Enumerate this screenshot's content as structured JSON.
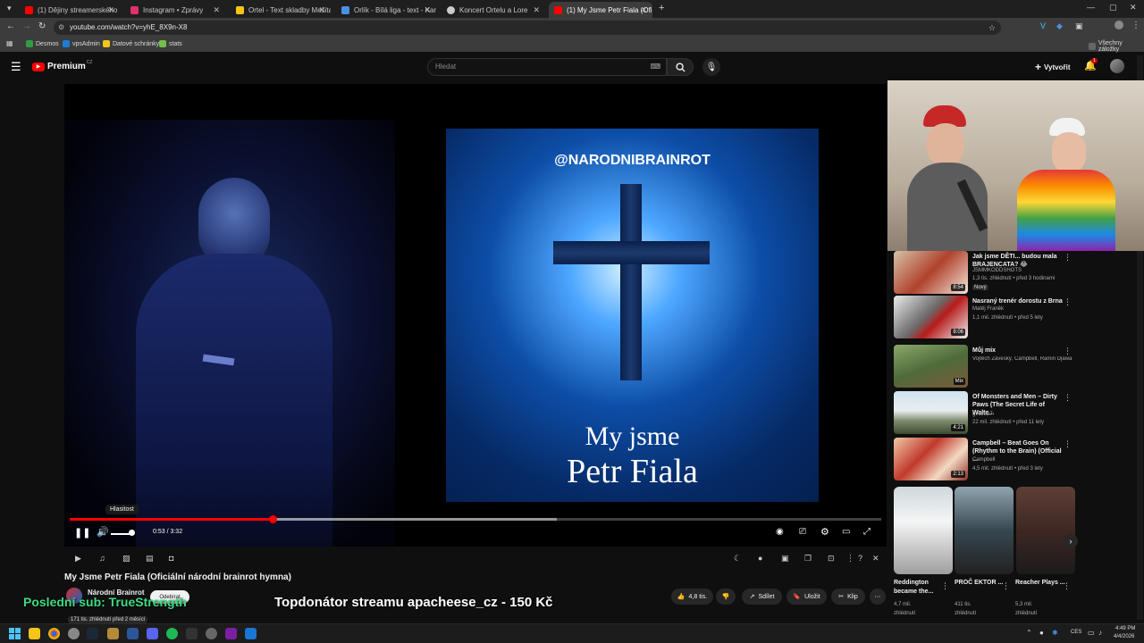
{
  "browser": {
    "tabs": [
      {
        "label": "(1) Dějiny streamerského národa",
        "color": "#ff0000"
      },
      {
        "label": "Instagram • Zprávy",
        "color": "#e1306c"
      },
      {
        "label": "Ortel - Text skladby Mešita z alba",
        "color": "#f5c518"
      },
      {
        "label": "Orlík - Bílá liga - text - Karaoke",
        "color": "#4a90e2"
      },
      {
        "label": "Koncert Ortelu a Lore",
        "color": "#cccccc"
      },
      {
        "label": "(1) My Jsme Petr Fiala (Ofici...",
        "color": "#ff0000"
      }
    ],
    "url": "youtube.com/watch?v=yhE_8X9n-X8",
    "bookmarks": [
      "Desmos",
      "vpsAdmin",
      "Datové schránky",
      "stats"
    ],
    "all_bookmarks": "Všechny záložky"
  },
  "youtube": {
    "logo": "Premium",
    "logo_region": "CZ",
    "search_placeholder": "Hledat",
    "create_label": "Vytvořit",
    "notification_count": "1"
  },
  "player": {
    "poster_handle": "@NARODNIBRAINROT",
    "poster_line1": "My jsme",
    "poster_line2": "Petr Fiala",
    "tooltip": "Hlasitost",
    "time": "0:53 / 3:32",
    "progress": 0.25,
    "buffered": 0.6
  },
  "video": {
    "title": "My Jsme Petr Fiala (Oficiální národní brainrot hymna)",
    "channel": "Národní Brainrot",
    "subscribe": "Odebírat",
    "views": "171 tis. zhlédnutí  před 2 měsíci",
    "likes": "4,8 tis.",
    "share": "Sdílet",
    "save": "Uložit",
    "clip": "Klip"
  },
  "sidebar": {
    "items": [
      {
        "title": "Jak jsme DĚTI... budou mala BRAJENCATA? 😂",
        "channel": "JSMMKODDSHOTS",
        "meta": "1,3 tis. zhlédnutí • před 3 hodinami",
        "badge": "Nový",
        "duration": "8:54"
      },
      {
        "title": "Nasraný trenér dorostu z Brna",
        "channel": "Matěj Franěk",
        "meta": "1,1 mil. zhlédnutí • před 5 lety",
        "badge": "",
        "duration": "8:06"
      },
      {
        "title": "Můj mix",
        "channel": "Vojtěch Záveský, Campbell, Ramin Djawa...",
        "meta": "",
        "badge": "",
        "duration": "Mix"
      },
      {
        "title": "Of Monsters and Men – Dirty Paws (The Secret Life of Walte...",
        "channel": "gvozd17",
        "meta": "22 mil. zhlédnutí • před 11 lety",
        "badge": "",
        "duration": "4:21"
      },
      {
        "title": "Campbell – Beat Goes On (Rhythm to the Brain) (Official ...",
        "channel": "Campbell",
        "meta": "4,5 mil. zhlédnutí • před 3 lety",
        "badge": "",
        "duration": "2:13"
      }
    ],
    "shorts": [
      {
        "title": "Reddington became the...",
        "views": "4,7 mil. zhlédnutí"
      },
      {
        "title": "PROČ EKTOR ...",
        "views": "411 tis. zhlédnutí"
      },
      {
        "title": "Reacher Plays ...",
        "views": "5,3 mil. zhlédnutí"
      }
    ]
  },
  "overlay": {
    "last_sub": "Poslední sub: TrueStrength",
    "top_donor": "Topdonátor streamu apacheese_cz - 150 Kč"
  },
  "taskbar": {
    "lang": "CES",
    "time": "4:49 PM",
    "date": "4/4/2026"
  }
}
